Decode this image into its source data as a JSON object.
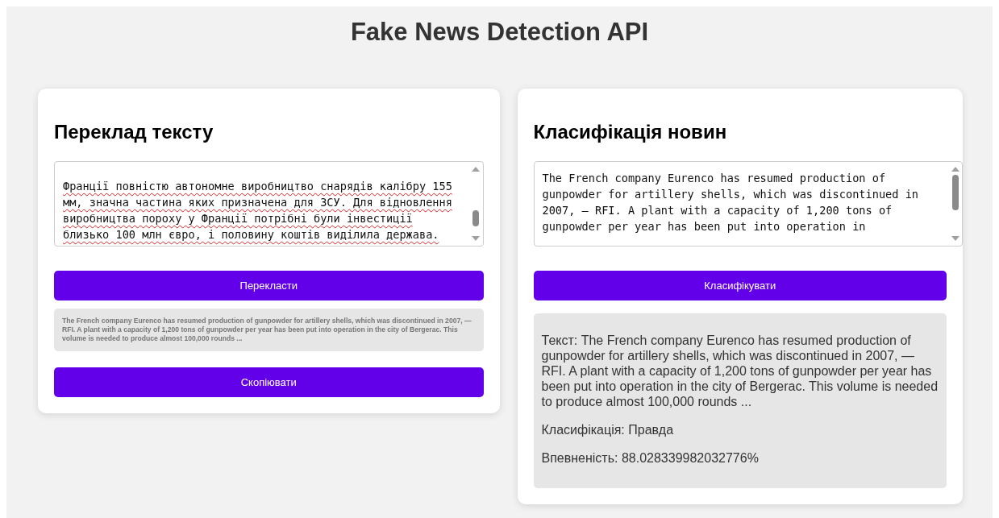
{
  "title": "Fake News Detection API",
  "panels": [
    {
      "kind": "translate",
      "heading": "Переклад тексту",
      "input": {
        "value": "Франції повністю автономне виробництво снарядів калібру 155 мм, значна частина яких призначена для ЗСУ. Для відновлення виробництва пороху у Франції потрібні були інвестиції близько 100 млн євро, і половину коштів виділила держава.",
        "spellcheck": true
      },
      "button": "Перекласти",
      "output": "The French company Eurenco has resumed production of gunpowder for artillery shells, which was discontinued in 2007, — RFI. A plant with a capacity of 1,200 tons of gunpowder per year has been put into operation in the city of Bergerac. This volume is needed to produce almost 100,000 rounds ...",
      "second_button": "Скопіювати"
    },
    {
      "kind": "classify",
      "heading": "Класифікація новин",
      "input": {
        "value": "The French company Eurenco has resumed production of gunpowder for artillery shells, which was discontinued in 2007, — RFI. A plant with a capacity of 1,200 tons of gunpowder per year has been put into operation in",
        "spellcheck": false
      },
      "button": "Класифікувати",
      "result": [
        "Текст: The French company Eurenco has resumed production of gunpowder for artillery shells, which was discontinued in 2007, — RFI. A plant with a capacity of 1,200 tons of gunpowder per year has been put into operation in the city of Bergerac. This volume is needed to produce almost 100,000 rounds ...",
        "Класифікація: Правда",
        "Впевненість: 88.028339982032776%"
      ]
    }
  ]
}
